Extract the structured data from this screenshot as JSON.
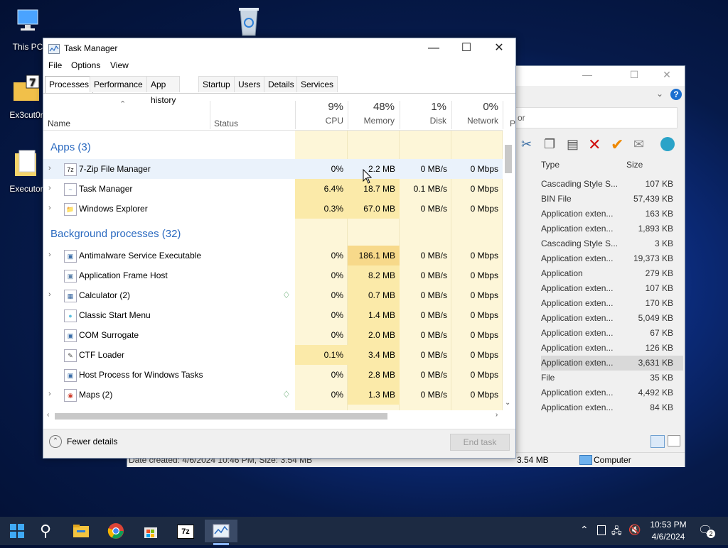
{
  "desktop": {
    "icons": [
      {
        "label": "This PC"
      },
      {
        "label": "Ex3cut0r"
      },
      {
        "label": "Executor"
      },
      {
        "label": ""
      }
    ]
  },
  "filemanager": {
    "col_type": "Type",
    "col_size": "Size",
    "search_placeholder": "or",
    "rows": [
      {
        "type": "Cascading Style S...",
        "size": "107 KB"
      },
      {
        "type": "BIN File",
        "size": "57,439 KB"
      },
      {
        "type": "Application exten...",
        "size": "163 KB"
      },
      {
        "type": "Application exten...",
        "size": "1,893 KB"
      },
      {
        "type": "Cascading Style S...",
        "size": "3 KB"
      },
      {
        "type": "Application exten...",
        "size": "19,373 KB"
      },
      {
        "type": "Application",
        "size": "279 KB"
      },
      {
        "type": "Application exten...",
        "size": "107 KB"
      },
      {
        "type": "Application exten...",
        "size": "170 KB"
      },
      {
        "type": "Application exten...",
        "size": "5,049 KB"
      },
      {
        "type": "Application exten...",
        "size": "67 KB"
      },
      {
        "type": "Application exten...",
        "size": "126 KB"
      },
      {
        "type": "Application exten...",
        "size": "3,631 KB"
      },
      {
        "type": "File",
        "size": "35 KB"
      },
      {
        "type": "Application exten...",
        "size": "4,492 KB"
      },
      {
        "type": "Application exten...",
        "size": "84 KB"
      }
    ],
    "status_left": "Date created: 4/6/2024 10:46 PM, Size: 3.54 MB",
    "status_size": "3.54 MB",
    "status_computer": "Computer"
  },
  "taskmanager": {
    "title": "Task Manager",
    "menu": [
      "File",
      "Options",
      "View"
    ],
    "tabs": [
      "Processes",
      "Performance",
      "App history",
      "Startup",
      "Users",
      "Details",
      "Services"
    ],
    "columns": {
      "name": "Name",
      "status": "Status",
      "cpu_pct": "9%",
      "cpu": "CPU",
      "mem_pct": "48%",
      "mem": "Memory",
      "disk_pct": "1%",
      "disk": "Disk",
      "net_pct": "0%",
      "net": "Network",
      "extra": "P"
    },
    "apps_header": "Apps (3)",
    "bg_header": "Background processes (32)",
    "apps": [
      {
        "name": "7-Zip File Manager",
        "cpu": "0%",
        "mem": "2.2 MB",
        "disk": "0 MB/s",
        "net": "0 Mbps"
      },
      {
        "name": "Task Manager",
        "cpu": "6.4%",
        "mem": "18.7 MB",
        "disk": "0.1 MB/s",
        "net": "0 Mbps"
      },
      {
        "name": "Windows Explorer",
        "cpu": "0.3%",
        "mem": "67.0 MB",
        "disk": "0 MB/s",
        "net": "0 Mbps"
      }
    ],
    "background": [
      {
        "name": "Antimalware Service Executable",
        "cpu": "0%",
        "mem": "186.1 MB",
        "disk": "0 MB/s",
        "net": "0 Mbps"
      },
      {
        "name": "Application Frame Host",
        "cpu": "0%",
        "mem": "8.2 MB",
        "disk": "0 MB/s",
        "net": "0 Mbps"
      },
      {
        "name": "Calculator (2)",
        "cpu": "0%",
        "mem": "0.7 MB",
        "disk": "0 MB/s",
        "net": "0 Mbps"
      },
      {
        "name": "Classic Start Menu",
        "cpu": "0%",
        "mem": "1.4 MB",
        "disk": "0 MB/s",
        "net": "0 Mbps"
      },
      {
        "name": "COM Surrogate",
        "cpu": "0%",
        "mem": "2.0 MB",
        "disk": "0 MB/s",
        "net": "0 Mbps"
      },
      {
        "name": "CTF Loader",
        "cpu": "0.1%",
        "mem": "3.4 MB",
        "disk": "0 MB/s",
        "net": "0 Mbps"
      },
      {
        "name": "Host Process for Windows Tasks",
        "cpu": "0%",
        "mem": "2.8 MB",
        "disk": "0 MB/s",
        "net": "0 Mbps"
      },
      {
        "name": "Maps (2)",
        "cpu": "0%",
        "mem": "1.3 MB",
        "disk": "0 MB/s",
        "net": "0 Mbps"
      }
    ],
    "fewer_details": "Fewer details",
    "end_task": "End task"
  },
  "taskbar": {
    "time": "10:53 PM",
    "date": "4/6/2024",
    "notification_count": "2",
    "sevenzip_label": "7z"
  }
}
